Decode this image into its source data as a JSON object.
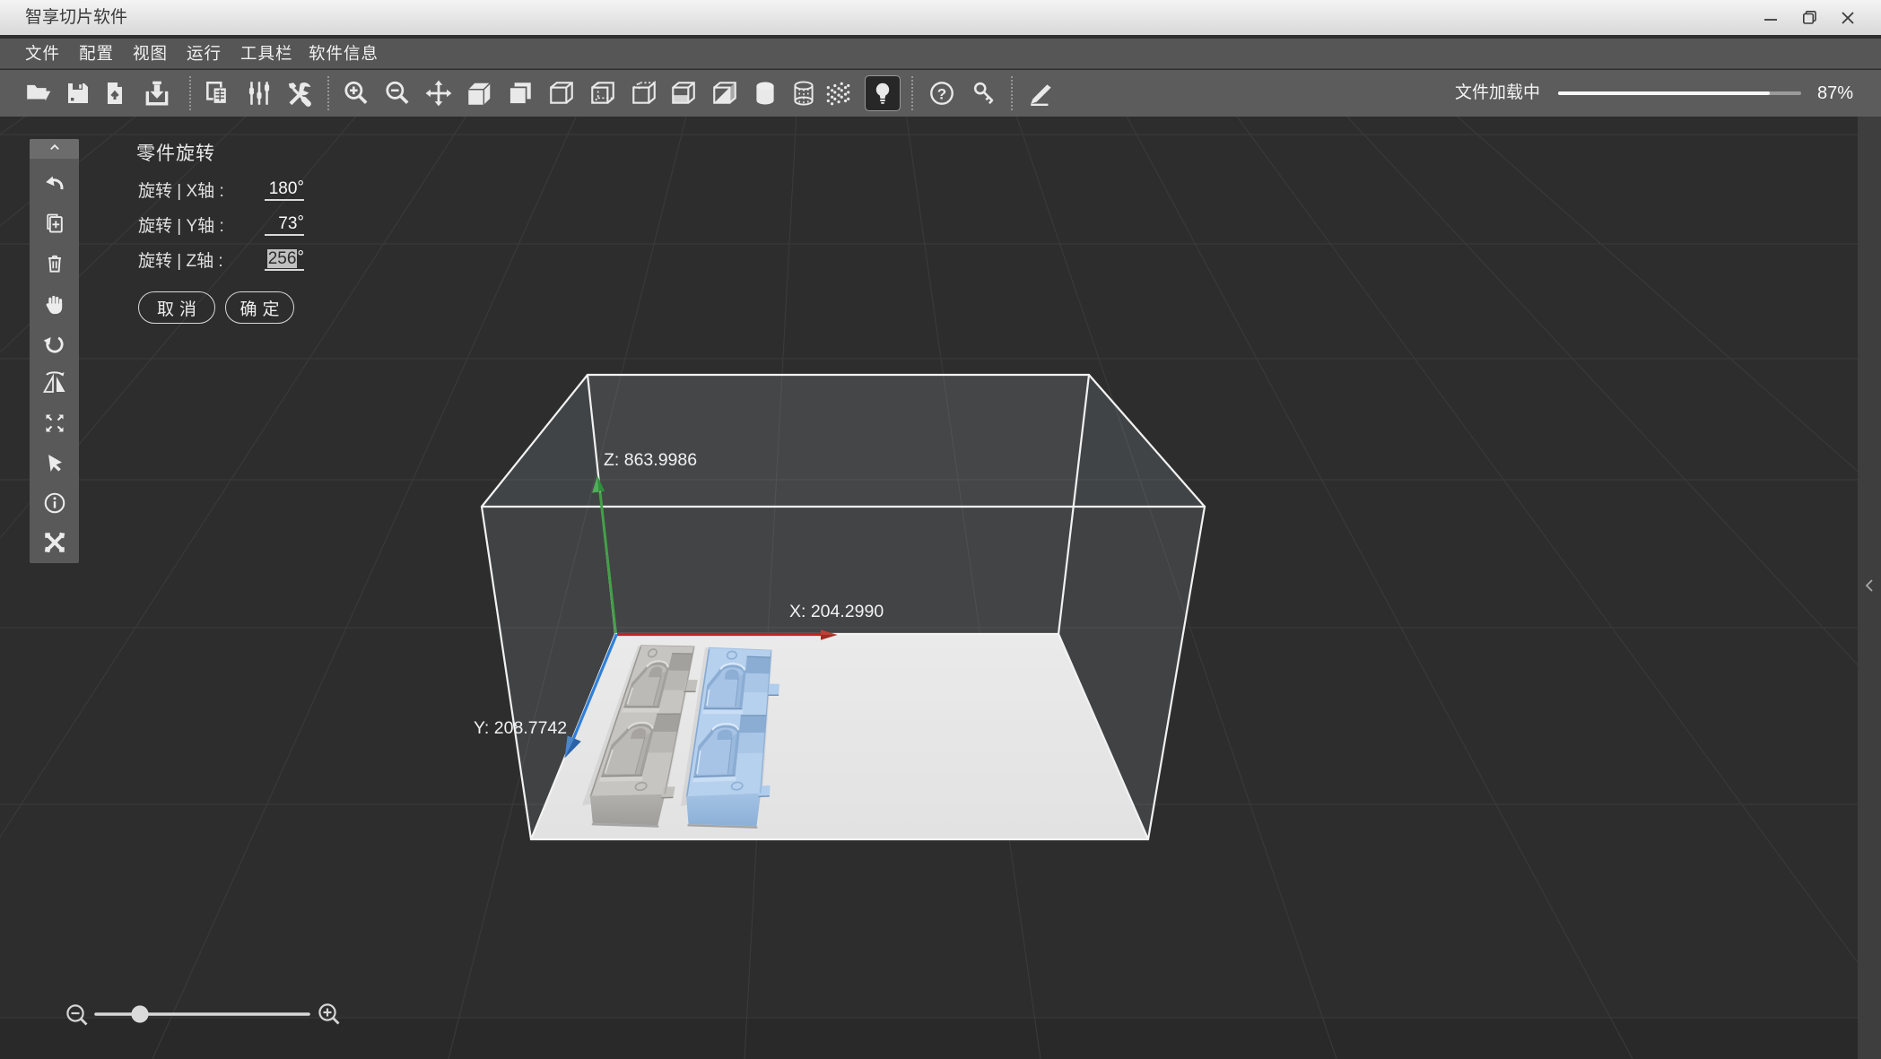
{
  "window": {
    "title": "智享切片软件",
    "controls": [
      {
        "name": "minimize"
      },
      {
        "name": "restore"
      },
      {
        "name": "close"
      }
    ]
  },
  "menu": {
    "items": [
      {
        "id": "file",
        "label": "文件"
      },
      {
        "id": "config",
        "label": "配置"
      },
      {
        "id": "view",
        "label": "视图"
      },
      {
        "id": "run",
        "label": "运行"
      },
      {
        "id": "toolbar",
        "label": "工具栏"
      },
      {
        "id": "software-info",
        "label": "软件信息"
      }
    ]
  },
  "toolbar": {
    "groups": [
      {
        "icons": [
          "open-file",
          "save",
          "import-file",
          "export-file"
        ]
      },
      {
        "icons": [
          "copy-plate",
          "adjust-params",
          "repair-tools"
        ]
      },
      {
        "icons": [
          "zoom-in",
          "zoom-out",
          "move",
          "view-solid-cube",
          "view-back-face",
          "view-wire-cube",
          "view-hidden-edges",
          "view-dashed-cube",
          "view-open-cube",
          "view-half-cube",
          "view-cylinder",
          "view-wire-cylinder",
          "view-point-cloud",
          "toggle-light"
        ]
      },
      {
        "icons": [
          "help",
          "license-key"
        ]
      },
      {
        "icons": [
          "annotate-pen"
        ]
      }
    ],
    "active_icon": "toggle-light",
    "progress": {
      "label": "文件加载中",
      "percent_text": "87%",
      "value": 87
    }
  },
  "side_toolbar": {
    "collapse_icon": "chevron-up",
    "items": [
      "undo",
      "add-part",
      "delete-part",
      "pan-view",
      "rotate-view",
      "mirror-part",
      "fit-view",
      "select-part",
      "part-info",
      "model-repair"
    ]
  },
  "rotate_panel": {
    "title": "零件旋转",
    "rows": [
      {
        "axis": "x",
        "label": "旋转 | X轴 :",
        "value": "180",
        "unit": "°",
        "selected": false
      },
      {
        "axis": "y",
        "label": "旋转 | Y轴 :",
        "value": "73",
        "unit": "°",
        "selected": false
      },
      {
        "axis": "z",
        "label": "旋转 | Z轴 :",
        "value": "256",
        "unit": "°",
        "selected": true
      }
    ],
    "cancel_label": "取消",
    "confirm_label": "确定"
  },
  "viewport": {
    "axis_labels": {
      "z": "Z:  863.9986",
      "x": "X: 204.2990",
      "y": "Y:  208.7742"
    },
    "colors": {
      "background": "#2d2d2d",
      "grid": "#3a3a3a",
      "axis_x": "#c62121",
      "axis_y": "#2f7fd8",
      "axis_z": "#43a047",
      "build_plate": "#e6e6e6",
      "model_gray": "#c7c5c2",
      "model_blue": "#b6d1ee"
    },
    "models": [
      {
        "name": "tray-gray",
        "color_key": "model_gray",
        "selected": false
      },
      {
        "name": "tray-blue",
        "color_key": "model_blue",
        "selected": true
      }
    ],
    "right_panel_toggle": "collapse-left-chevron"
  },
  "zoom_control": {
    "left_icon": "zoom-out-lens",
    "right_icon": "zoom-in-lens",
    "value_fraction": 0.2
  }
}
